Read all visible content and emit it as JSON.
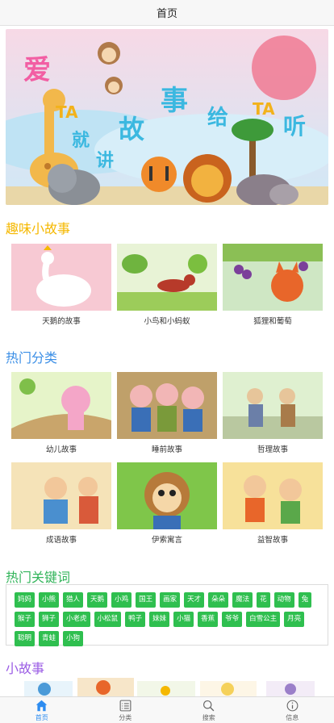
{
  "navbar": {
    "title": "首页"
  },
  "banner": {
    "chars": [
      "爱",
      "TA",
      "就",
      "讲",
      "故",
      "事",
      "给",
      "TA",
      "听"
    ]
  },
  "sections": {
    "stories": "趣味小故事",
    "categories": "热门分类",
    "keywords": "热门关键词",
    "small": "小故事"
  },
  "stories": [
    {
      "title": "天鹅的故事"
    },
    {
      "title": "小鸟和小蚂蚁"
    },
    {
      "title": "狐狸和葡萄"
    }
  ],
  "categories": [
    {
      "title": "幼儿故事"
    },
    {
      "title": "睡前故事"
    },
    {
      "title": "哲理故事"
    },
    {
      "title": "成语故事"
    },
    {
      "title": "伊索寓言"
    },
    {
      "title": "益智故事"
    }
  ],
  "keywords": [
    "妈妈",
    "小熊",
    "猎人",
    "天鹅",
    "小鸡",
    "国王",
    "画家",
    "天才",
    "朵朵",
    "魔法",
    "花",
    "动物",
    "兔",
    "猴子",
    "狮子",
    "小老虎",
    "小松鼠",
    "鸭子",
    "妹妹",
    "小猫",
    "香蕉",
    "爷爷",
    "白雪公主",
    "月亮",
    "聪明",
    "青蛙",
    "小狗"
  ],
  "tabs": [
    {
      "label": "首页",
      "icon": "home-icon",
      "active": true
    },
    {
      "label": "分类",
      "icon": "list-icon",
      "active": false
    },
    {
      "label": "搜索",
      "icon": "search-icon",
      "active": false
    },
    {
      "label": "信息",
      "icon": "info-icon",
      "active": false
    }
  ],
  "colors": {
    "stories_title": "#f5b800",
    "categories_title": "#3a8ee6",
    "keywords_title": "#32b45a",
    "small_title": "#9b5de5",
    "keyword_tag": "#2fbf4f",
    "tab_active": "#2d8cf0"
  }
}
